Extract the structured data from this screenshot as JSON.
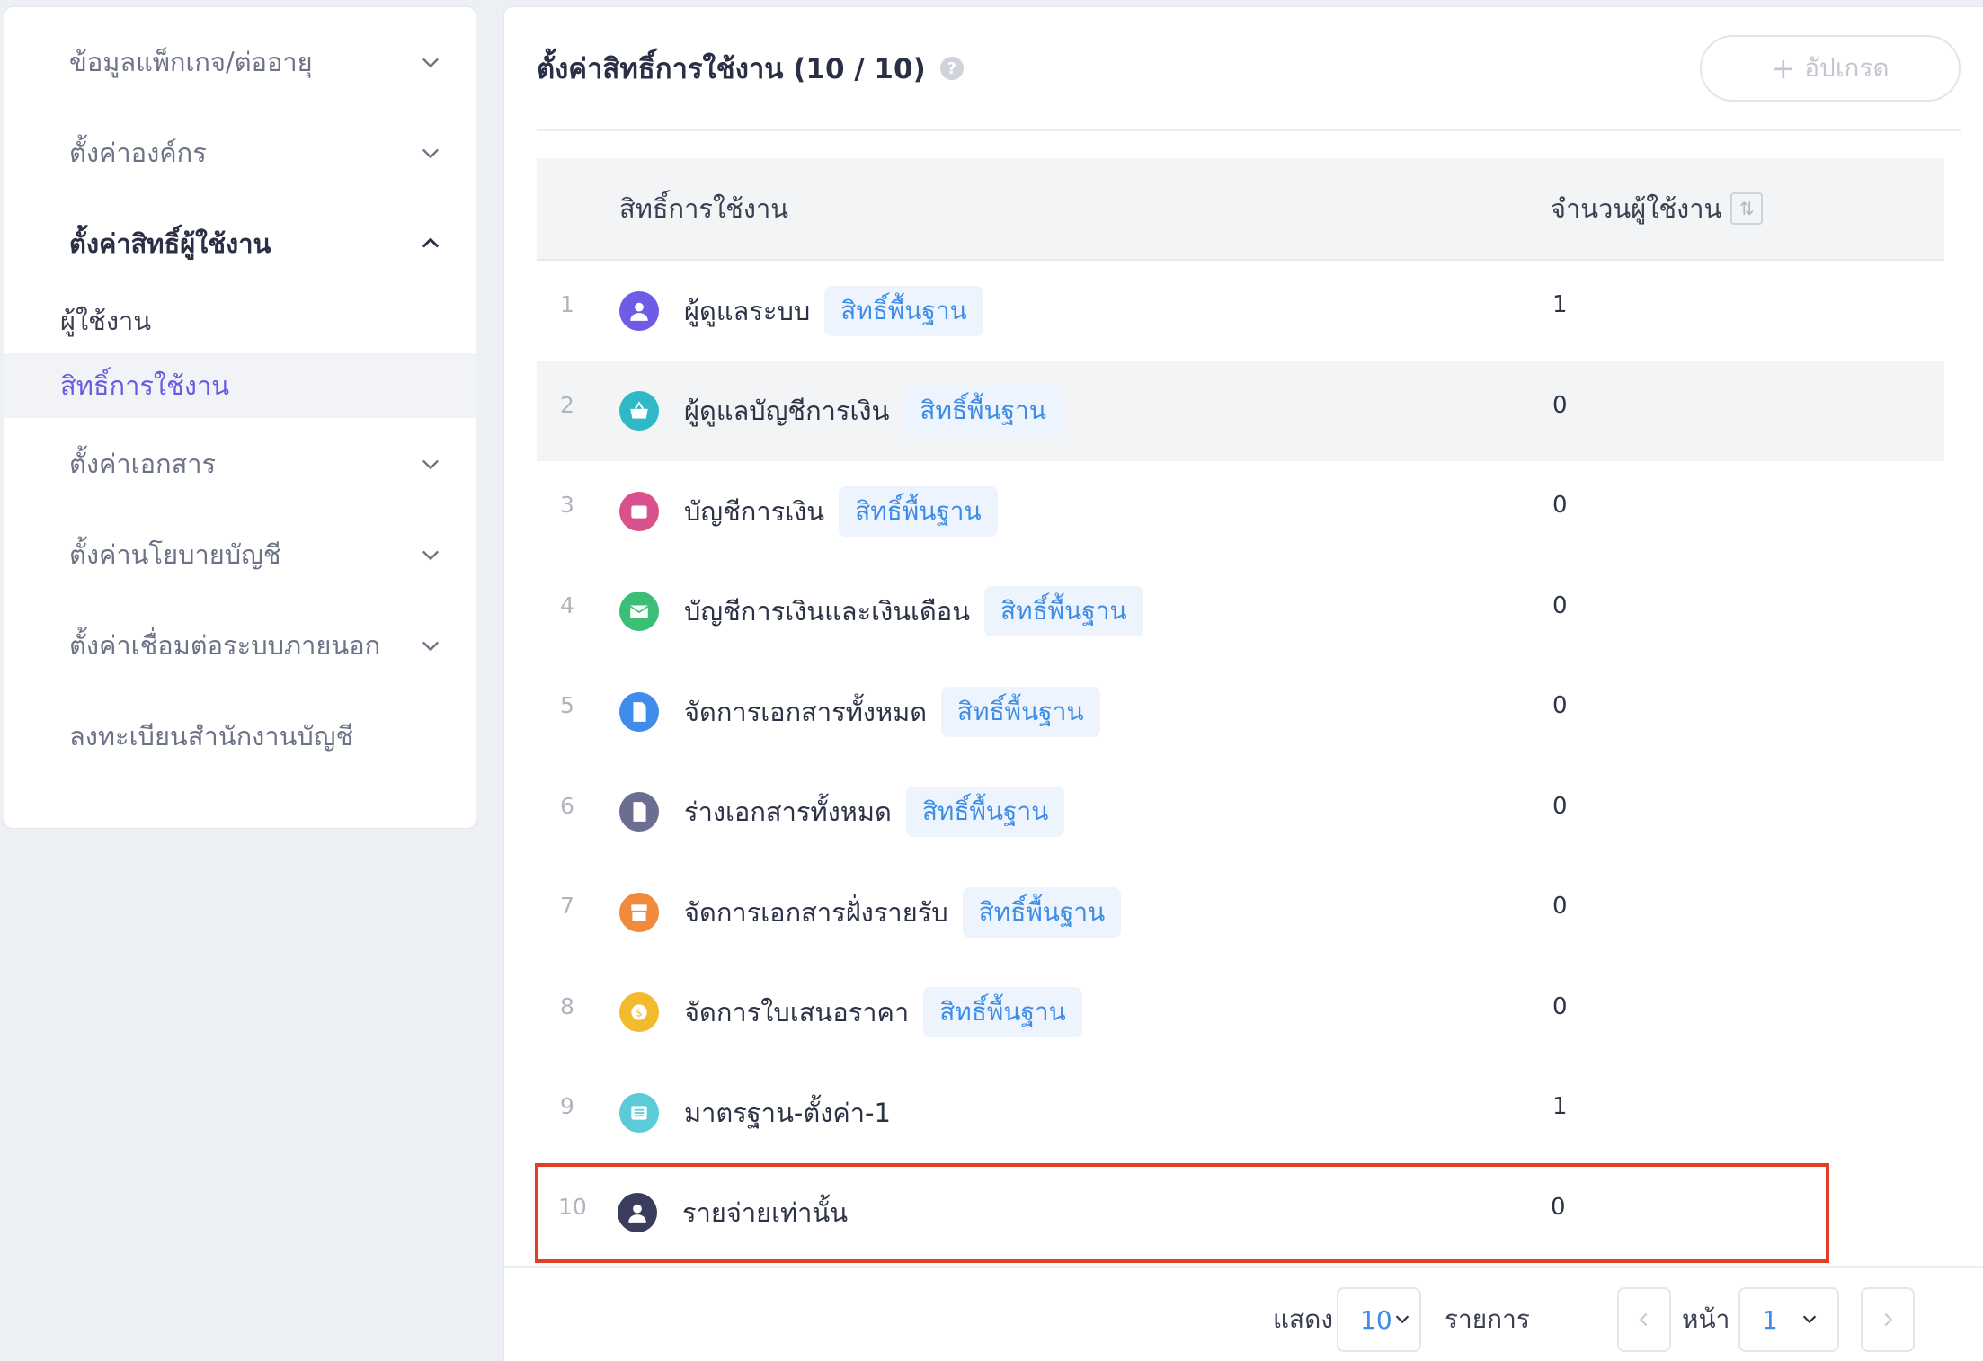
{
  "sidebar": {
    "items": [
      {
        "label": "ข้อมูลแพ็กเกจ/ต่ออายุ",
        "chevron": "down"
      },
      {
        "label": "ตั้งค่าองค์กร",
        "chevron": "down"
      },
      {
        "label": "ตั้งค่าสิทธิ์ผู้ใช้งาน",
        "chevron": "up"
      },
      {
        "label": "ตั้งค่าเอกสาร",
        "chevron": "down"
      },
      {
        "label": "ตั้งค่านโยบายบัญชี",
        "chevron": "down"
      },
      {
        "label": "ตั้งค่าเชื่อมต่อระบบภายนอก",
        "chevron": "down"
      },
      {
        "label": "ลงทะเบียนสำนักงานบัญชี"
      }
    ],
    "subitems": [
      {
        "label": "ผู้ใช้งาน"
      },
      {
        "label": "สิทธิ์การใช้งาน"
      }
    ]
  },
  "header": {
    "title": "ตั้งค่าสิทธิ์การใช้งาน (10 / 10)",
    "help": "?",
    "upgrade_plus": "+",
    "upgrade_label": "อัปเกรด"
  },
  "table": {
    "columns": {
      "name": "สิทธิ์การใช้งาน",
      "count": "จำนวนผู้ใช้งาน"
    },
    "sort_icon": "⇅",
    "rows": [
      {
        "index": "1",
        "name": "ผู้ดูแลระบบ",
        "badge": "สิทธิ์พื้นฐาน",
        "count": "1",
        "icon": "user-icon",
        "color": "#6f5ce6"
      },
      {
        "index": "2",
        "name": "ผู้ดูแลบัญชีการเงิน",
        "badge": "สิทธิ์พื้นฐาน",
        "count": "0",
        "icon": "basket-icon",
        "color": "#2fb8c6"
      },
      {
        "index": "3",
        "name": "บัญชีการเงิน",
        "badge": "สิทธิ์พื้นฐาน",
        "count": "0",
        "icon": "wallet-icon",
        "color": "#d8508c"
      },
      {
        "index": "4",
        "name": "บัญชีการเงินและเงินเดือน",
        "badge": "สิทธิ์พื้นฐาน",
        "count": "0",
        "icon": "envelope-icon",
        "color": "#3bbf77"
      },
      {
        "index": "5",
        "name": "จัดการเอกสารทั้งหมด",
        "badge": "สิทธิ์พื้นฐาน",
        "count": "0",
        "icon": "document-icon",
        "color": "#3f8ceb"
      },
      {
        "index": "6",
        "name": "ร่างเอกสารทั้งหมด",
        "badge": "สิทธิ์พื้นฐาน",
        "count": "0",
        "icon": "document-icon",
        "color": "#6b6e8f"
      },
      {
        "index": "7",
        "name": "จัดการเอกสารฝั่งรายรับ",
        "badge": "สิทธิ์พื้นฐาน",
        "count": "0",
        "icon": "store-icon",
        "color": "#f08a3c"
      },
      {
        "index": "8",
        "name": "จัดการใบเสนอราคา",
        "badge": "สิทธิ์พื้นฐาน",
        "count": "0",
        "icon": "coin-icon",
        "color": "#f2bb2d"
      },
      {
        "index": "9",
        "name": "มาตรฐาน-ตั้งค่า-1",
        "badge": "",
        "count": "1",
        "icon": "list-icon",
        "color": "#5bcbd8"
      },
      {
        "index": "10",
        "name": "รายจ่ายเท่านั้น",
        "badge": "",
        "count": "0",
        "icon": "user-icon",
        "color": "#3a3d5c"
      }
    ]
  },
  "pagination": {
    "show_label": "แสดง",
    "page_size": "10",
    "items_label": "รายการ",
    "page_label": "หน้า",
    "page": "1"
  },
  "colors": {
    "accent": "#6a5ae0",
    "badge_text": "#3d8ce6",
    "highlight": "#e23d27"
  }
}
